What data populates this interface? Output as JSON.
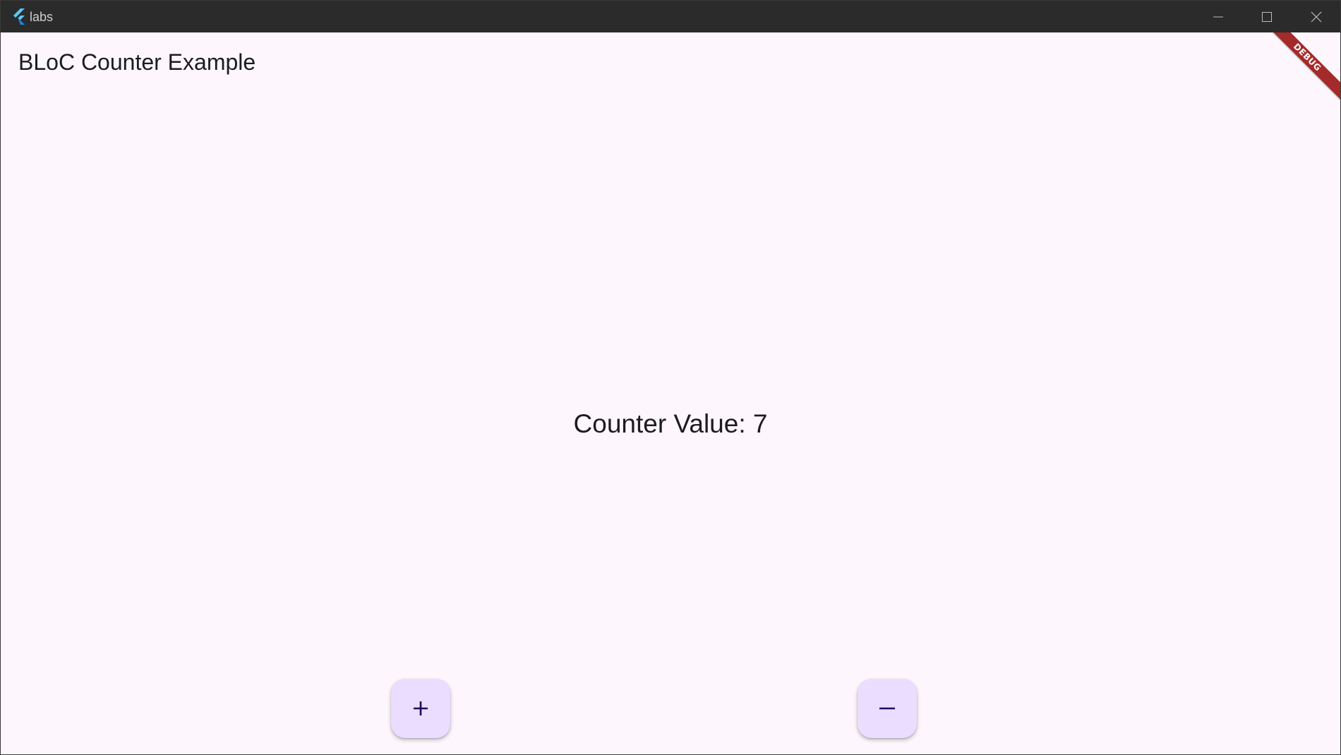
{
  "window": {
    "title": "labs",
    "app_icon": "flutter-logo-icon",
    "controls": [
      "minimize-icon",
      "maximize-icon",
      "close-icon"
    ]
  },
  "appbar": {
    "title": "BLoC Counter Example"
  },
  "body": {
    "counter_text": "Counter Value: 7"
  },
  "buttons": {
    "increment_icon": "plus-icon",
    "decrement_icon": "minus-icon"
  },
  "debug_banner": {
    "label": "DEBUG"
  },
  "colors": {
    "titlebar": "#2b2b2b",
    "background": "#fdf7fd",
    "fab": "#eaddff",
    "text": "#1d1b20",
    "debug_banner": "#a52a2a"
  }
}
